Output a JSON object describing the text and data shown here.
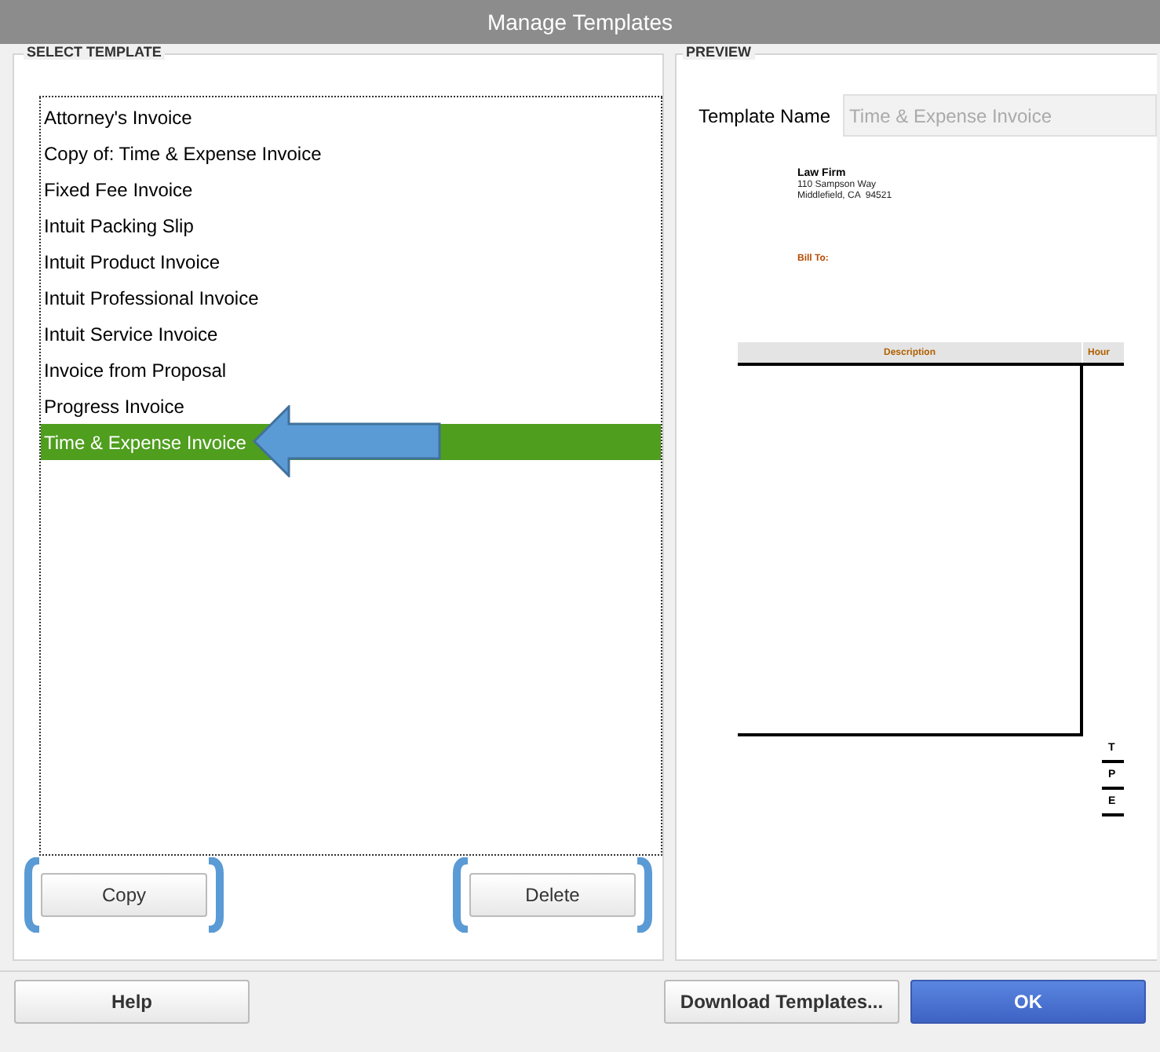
{
  "window": {
    "title": "Manage Templates"
  },
  "select_template": {
    "heading": "SELECT TEMPLATE",
    "items": [
      {
        "label": "Attorney's Invoice",
        "selected": false
      },
      {
        "label": "Copy of: Time & Expense Invoice",
        "selected": false
      },
      {
        "label": "Fixed Fee Invoice",
        "selected": false
      },
      {
        "label": "Intuit Packing Slip",
        "selected": false
      },
      {
        "label": "Intuit Product Invoice",
        "selected": false
      },
      {
        "label": "Intuit Professional Invoice",
        "selected": false
      },
      {
        "label": "Intuit Service Invoice",
        "selected": false
      },
      {
        "label": "Invoice from Proposal",
        "selected": false
      },
      {
        "label": "Progress Invoice",
        "selected": false
      },
      {
        "label": "Time & Expense Invoice",
        "selected": true
      }
    ],
    "buttons": [
      "Copy",
      "Delete"
    ]
  },
  "preview": {
    "heading": "PREVIEW",
    "template_name_label": "Template Name",
    "template_name_value": "Time & Expense Invoice",
    "company_name": "Law Firm",
    "address_lines": [
      "110 Sampson Way",
      "Middlefield, CA  94521"
    ],
    "bill_to": "Bill To:",
    "columns": [
      "Description",
      "Hour"
    ],
    "total_labels": [
      "T",
      "P",
      "E"
    ]
  },
  "footer_buttons": [
    {
      "label": "Help",
      "kind": "plain"
    },
    {
      "label": "Download Templates...",
      "kind": "plain"
    },
    {
      "label": "OK",
      "kind": "primary"
    }
  ]
}
